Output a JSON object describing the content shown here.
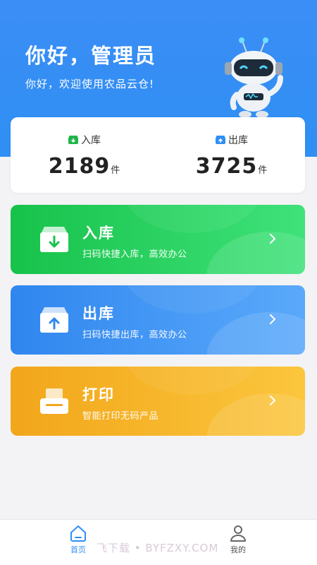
{
  "header": {
    "title": "你好，管理员",
    "subtitle": "你好，欢迎使用农品云仓!"
  },
  "stats": {
    "in": {
      "label": "入库",
      "value": "2189",
      "unit": "件",
      "icon": "box-in-icon",
      "color": "#1fb54a"
    },
    "out": {
      "label": "出库",
      "value": "3725",
      "unit": "件",
      "icon": "box-out-icon",
      "color": "#2f8ff4"
    }
  },
  "actions": [
    {
      "title": "入库",
      "desc": "扫码快捷入库，高效办公",
      "icon": "box-down-arrow-icon"
    },
    {
      "title": "出库",
      "desc": "扫码快捷出库，高效办公",
      "icon": "box-up-arrow-icon"
    },
    {
      "title": "打印",
      "desc": "智能打印无码产品",
      "icon": "printer-icon"
    }
  ],
  "tabbar": {
    "home": {
      "label": "首页",
      "icon": "home-icon",
      "active": true
    },
    "me": {
      "label": "我的",
      "icon": "user-icon",
      "active": false
    }
  },
  "watermark": "飞下载 • BYFZXY.COM",
  "colors": {
    "header": "#2f8ff4",
    "green": "#17c24a",
    "blue": "#2f86ee",
    "orange": "#f2a61a"
  }
}
